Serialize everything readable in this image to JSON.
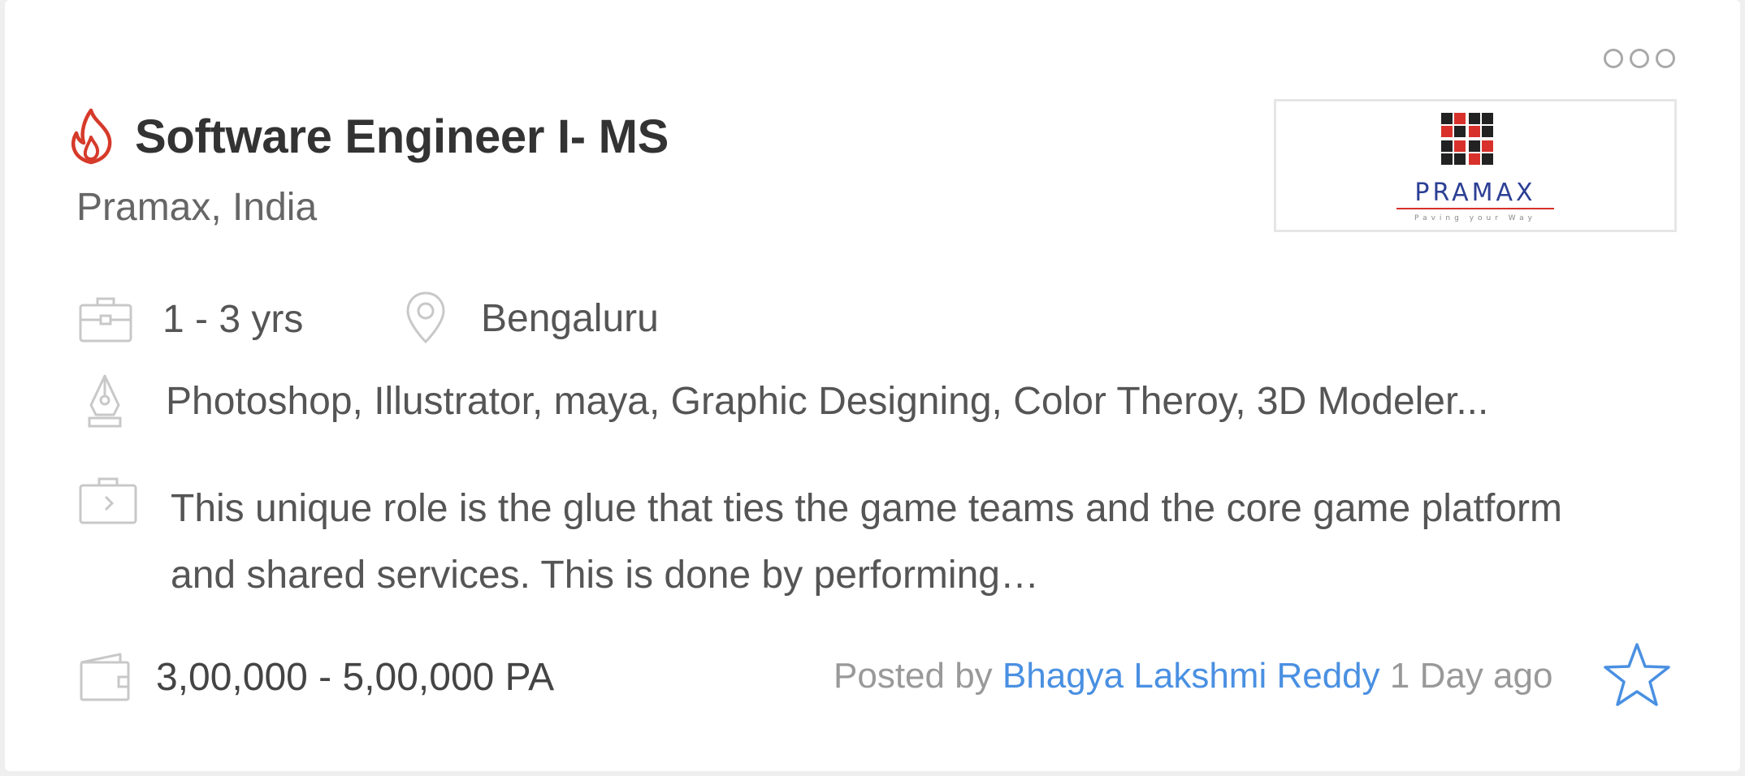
{
  "job": {
    "title": "Software Engineer I- MS",
    "company": "Pramax, India",
    "experience": "1 - 3 yrs",
    "location": "Bengaluru",
    "skills": "Photoshop, Illustrator, maya, Graphic Designing, Color Theroy, 3D Modeler...",
    "description": "This unique role is the glue that ties the game teams and the core game platform and shared services. This is done by performing…",
    "salary": "3,00,000 - 5,00,000 PA",
    "posted_prefix": "Posted by",
    "posted_by": "Bhagya Lakshmi Reddy",
    "posted_when": "1 Day ago",
    "logo_text": "PRAMAX",
    "logo_tagline": "Paving your Way"
  },
  "icons": {
    "hot": "fire-icon",
    "more": "more-options-icon",
    "experience": "briefcase-icon",
    "location": "location-pin-icon",
    "skills": "pen-nib-icon",
    "description": "job-description-icon",
    "salary": "wallet-icon",
    "save": "star-icon"
  },
  "colors": {
    "hot": "#d63a2a",
    "link": "#4a90e2",
    "icon": "#c8c8c8",
    "title": "#333333",
    "logo_red": "#d8312b",
    "logo_blue": "#2c3f94"
  }
}
